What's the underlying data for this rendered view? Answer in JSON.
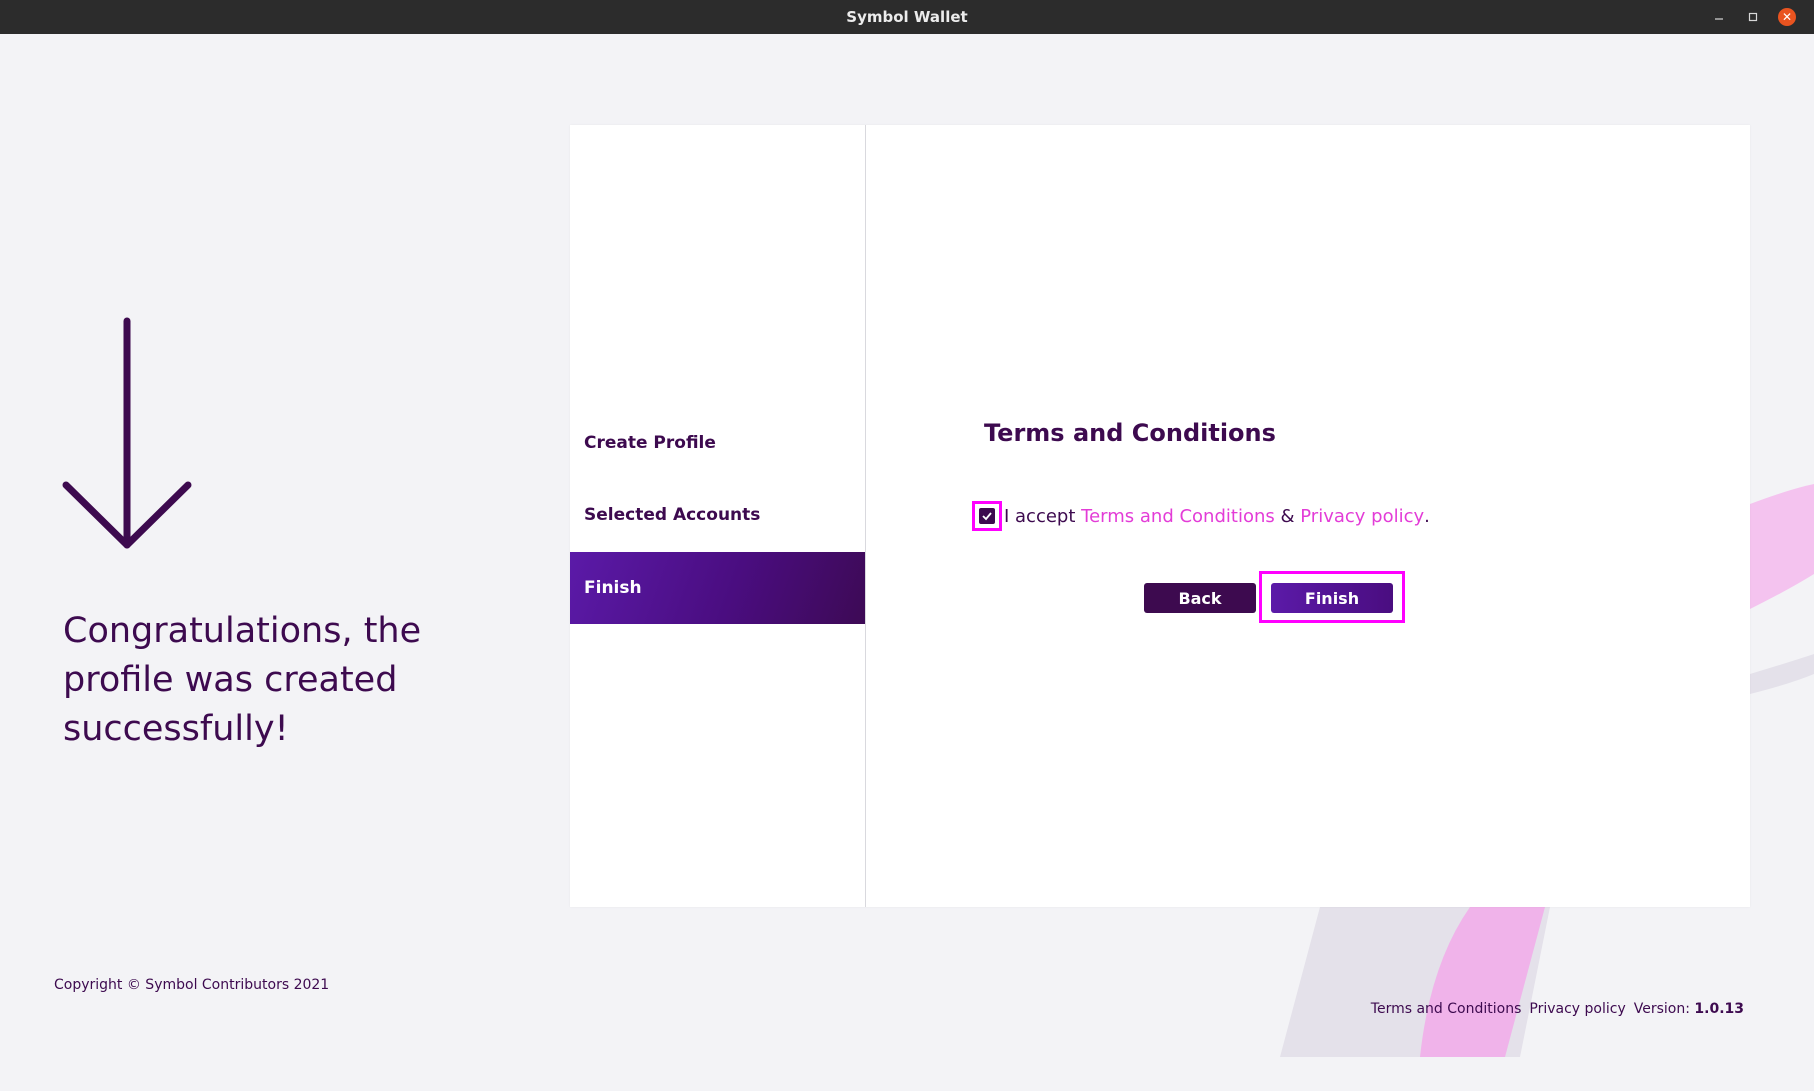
{
  "window": {
    "title": "Symbol Wallet"
  },
  "left": {
    "message": "Congratulations, the profile was created successfully!",
    "copyright": "Copyright © Symbol Contributors 2021"
  },
  "steps": [
    {
      "label": "Create Profile",
      "active": false
    },
    {
      "label": "Selected Accounts",
      "active": false
    },
    {
      "label": "Finish",
      "active": true
    }
  ],
  "terms": {
    "title": "Terms and Conditions",
    "accept_prefix": "I accept",
    "terms_link": "Terms and Conditions",
    "ampersand": "&",
    "privacy_link": "Privacy policy",
    "period": ".",
    "checked": true
  },
  "buttons": {
    "back": "Back",
    "finish": "Finish"
  },
  "footer": {
    "terms_link": "Terms and Conditions",
    "privacy_link": "Privacy policy",
    "version_label": "Version:",
    "version_value": "1.0.13"
  },
  "colors": {
    "primary": "#3d0a4f",
    "accent": "#5b1aa8",
    "link": "#e33cd7",
    "highlight": "#ff00ff",
    "close_button": "#e95420"
  },
  "icons": [
    "down-arrow-icon",
    "checkmark-icon",
    "minimize-icon",
    "maximize-icon",
    "close-icon"
  ]
}
